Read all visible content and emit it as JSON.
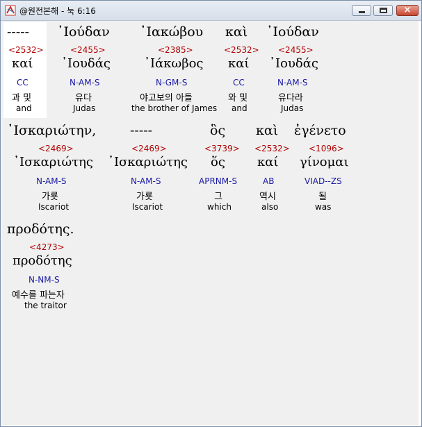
{
  "window": {
    "title": "@원전본해 - 눅 6:16",
    "minimize": "minimize",
    "maximize": "maximize",
    "close": "×"
  },
  "rows": [
    {
      "words": [
        {
          "greek": "-----",
          "strong": "<2532>",
          "lemma": "καί",
          "morph": "CC",
          "korean": "과 및",
          "english": "and"
        },
        {
          "greek": "᾿Ιούδαν",
          "strong": "<2455>",
          "lemma": "᾿Ιουδάς",
          "morph": "N-AM-S",
          "korean": "유다",
          "english": "Judas"
        },
        {
          "greek": "᾿Ιακώβου",
          "strong": "<2385>",
          "lemma": "᾿Ιάκωβος",
          "morph": "N-GM-S",
          "korean": "야고보의 아들",
          "english": "the brother of James"
        },
        {
          "greek": "καὶ",
          "strong": "<2532>",
          "lemma": "καί",
          "morph": "CC",
          "korean": "와 및",
          "english": "and"
        },
        {
          "greek": "᾿Ιούδαν",
          "strong": "<2455>",
          "lemma": "᾿Ιουδάς",
          "morph": "N-AM-S",
          "korean": "유다라",
          "english": "Judas"
        }
      ]
    },
    {
      "words": [
        {
          "greek": "᾿Ισκαριώτην,",
          "strong": "<2469>",
          "lemma": "᾿Ισκαριώτης",
          "morph": "N-AM-S",
          "korean": "가룟",
          "english": "Iscariot"
        },
        {
          "greek": "-----",
          "strong": "<2469>",
          "lemma": "᾿Ισκαριώτης",
          "morph": "N-AM-S",
          "korean": "가룟",
          "english": "Iscariot"
        },
        {
          "greek": "ὃς",
          "strong": "<3739>",
          "lemma": "ὅς",
          "morph": "APRNM-S",
          "korean": "그",
          "english": "which"
        },
        {
          "greek": "καὶ",
          "strong": "<2532>",
          "lemma": "καί",
          "morph": "AB",
          "korean": "역시",
          "english": "also"
        },
        {
          "greek": "ἐγένετο",
          "strong": "<1096>",
          "lemma": "γίνομαι",
          "morph": "VIAD--ZS",
          "korean": "될",
          "english": "was"
        }
      ]
    },
    {
      "words": [
        {
          "greek": "προδότης.",
          "strong": "<4273>",
          "lemma": "προδότης",
          "morph": "N-NM-S",
          "korean": "예수를 파는자",
          "english": "the traitor"
        }
      ]
    }
  ]
}
